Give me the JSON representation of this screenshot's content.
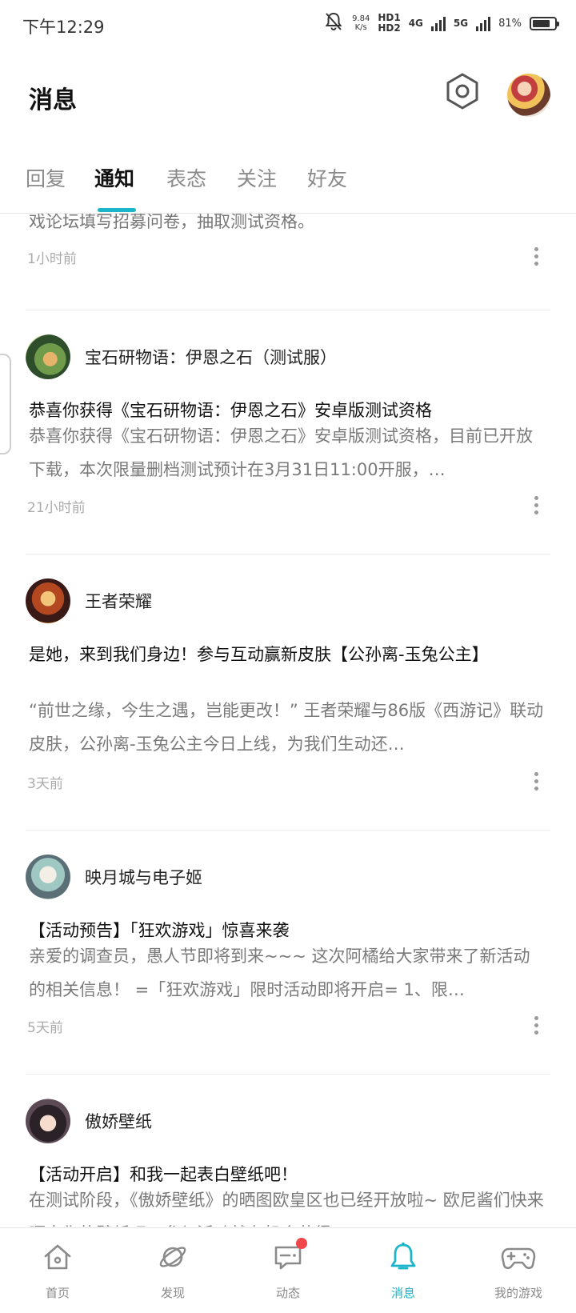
{
  "status_bar": {
    "time": "下午12:29",
    "speed_value": "9.84",
    "speed_unit": "K/s",
    "hd1": "HD1",
    "hd2": "HD2",
    "net1": "4G",
    "net2": "5G",
    "battery_percent": "81%",
    "battery_level": 0.81,
    "icons": [
      "mute-bell-icon",
      "signal-icon",
      "battery-icon"
    ]
  },
  "header": {
    "title": "消息",
    "settings_icon": "hexagon-gear-icon",
    "avatar": "user-avatar"
  },
  "tabs": [
    {
      "label": "回复",
      "active": false
    },
    {
      "label": "通知",
      "active": true
    },
    {
      "label": "表态",
      "active": false
    },
    {
      "label": "关注",
      "active": false
    },
    {
      "label": "好友",
      "active": false
    }
  ],
  "notifications": [
    {
      "body_tail": "戏论坛填写招募问卷，抽取测试资格。",
      "time": "1小时前"
    },
    {
      "sender": "宝石研物语：伊恩之石（测试服）",
      "title": "恭喜你获得《宝石研物语：伊恩之石》安卓版测试资格",
      "body": "恭喜你获得《宝石研物语：伊恩之石》安卓版测试资格，目前已开放下载，本次限量删档测试预计在3月31日11:00开服，…",
      "time": "21小时前"
    },
    {
      "sender": "王者荣耀",
      "title": "是她，来到我们身边！参与互动赢新皮肤【公孙离-玉兔公主】",
      "body": "“前世之缘，今生之遇，岂能更改！” 王者荣耀与86版《西游记》联动皮肤，公孙离-玉兔公主今日上线，为我们生动还…",
      "time": "3天前"
    },
    {
      "sender": "映月城与电子姬",
      "title": "【活动预告】「狂欢游戏」惊喜来袭",
      "body": "亲爱的调查员，愚人节即将到来~~~ 这次阿橘给大家带来了新活动的相关信息！ =「狂欢游戏」限时活动即将开启= 1、限…",
      "time": "5天前"
    },
    {
      "sender": "傲娇壁纸",
      "title": "【活动开启】和我一起表白壁纸吧！",
      "body": "在测试阶段，《傲娇壁纸》的晒图欧皇区也已经开放啦~ 欧尼酱们快来晒出你的壁纸吧，参与活动就有机会获得…",
      "time": ""
    }
  ],
  "bottom_nav": [
    {
      "label": "首页",
      "icon": "home-icon",
      "active": false
    },
    {
      "label": "发现",
      "icon": "planet-icon",
      "active": false
    },
    {
      "label": "动态",
      "icon": "chat-bubble-icon",
      "active": false,
      "badge": true
    },
    {
      "label": "消息",
      "icon": "bell-icon",
      "active": true
    },
    {
      "label": "我的游戏",
      "icon": "gamepad-icon",
      "active": false
    }
  ],
  "colors": {
    "accent": "#1bb5c9",
    "badge": "#f0484a",
    "text_primary": "#111111",
    "text_secondary": "#7a7a7a",
    "text_muted": "#aaaaaa"
  }
}
